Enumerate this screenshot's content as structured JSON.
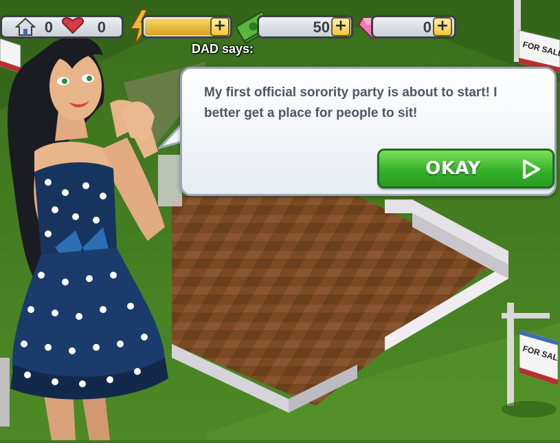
{
  "hud": {
    "houses_count": "0",
    "energy_plus": "+",
    "cash_value": "50",
    "cash_plus": "+",
    "gems_value": "0",
    "gems_plus": "+"
  },
  "dialog": {
    "speaker_label": "DAD says:",
    "message": "My first official sorority party is about to start! I better get a place for people to sit!",
    "okay_label": "OKAY"
  },
  "signs": {
    "for_sale_text": "FOR SALE"
  },
  "colors": {
    "grass": "#3f7a20",
    "floor": "#7a4a22",
    "okay_green": "#35b22a",
    "bubble_text": "#4a566b",
    "energy_fill": "#e9b52a"
  },
  "icons": {
    "house": "house-icon",
    "heart": "heart-icon",
    "energy": "lightning-icon",
    "cash": "cash-icon",
    "gem": "gem-icon",
    "okay": "play-arrow-icon"
  }
}
